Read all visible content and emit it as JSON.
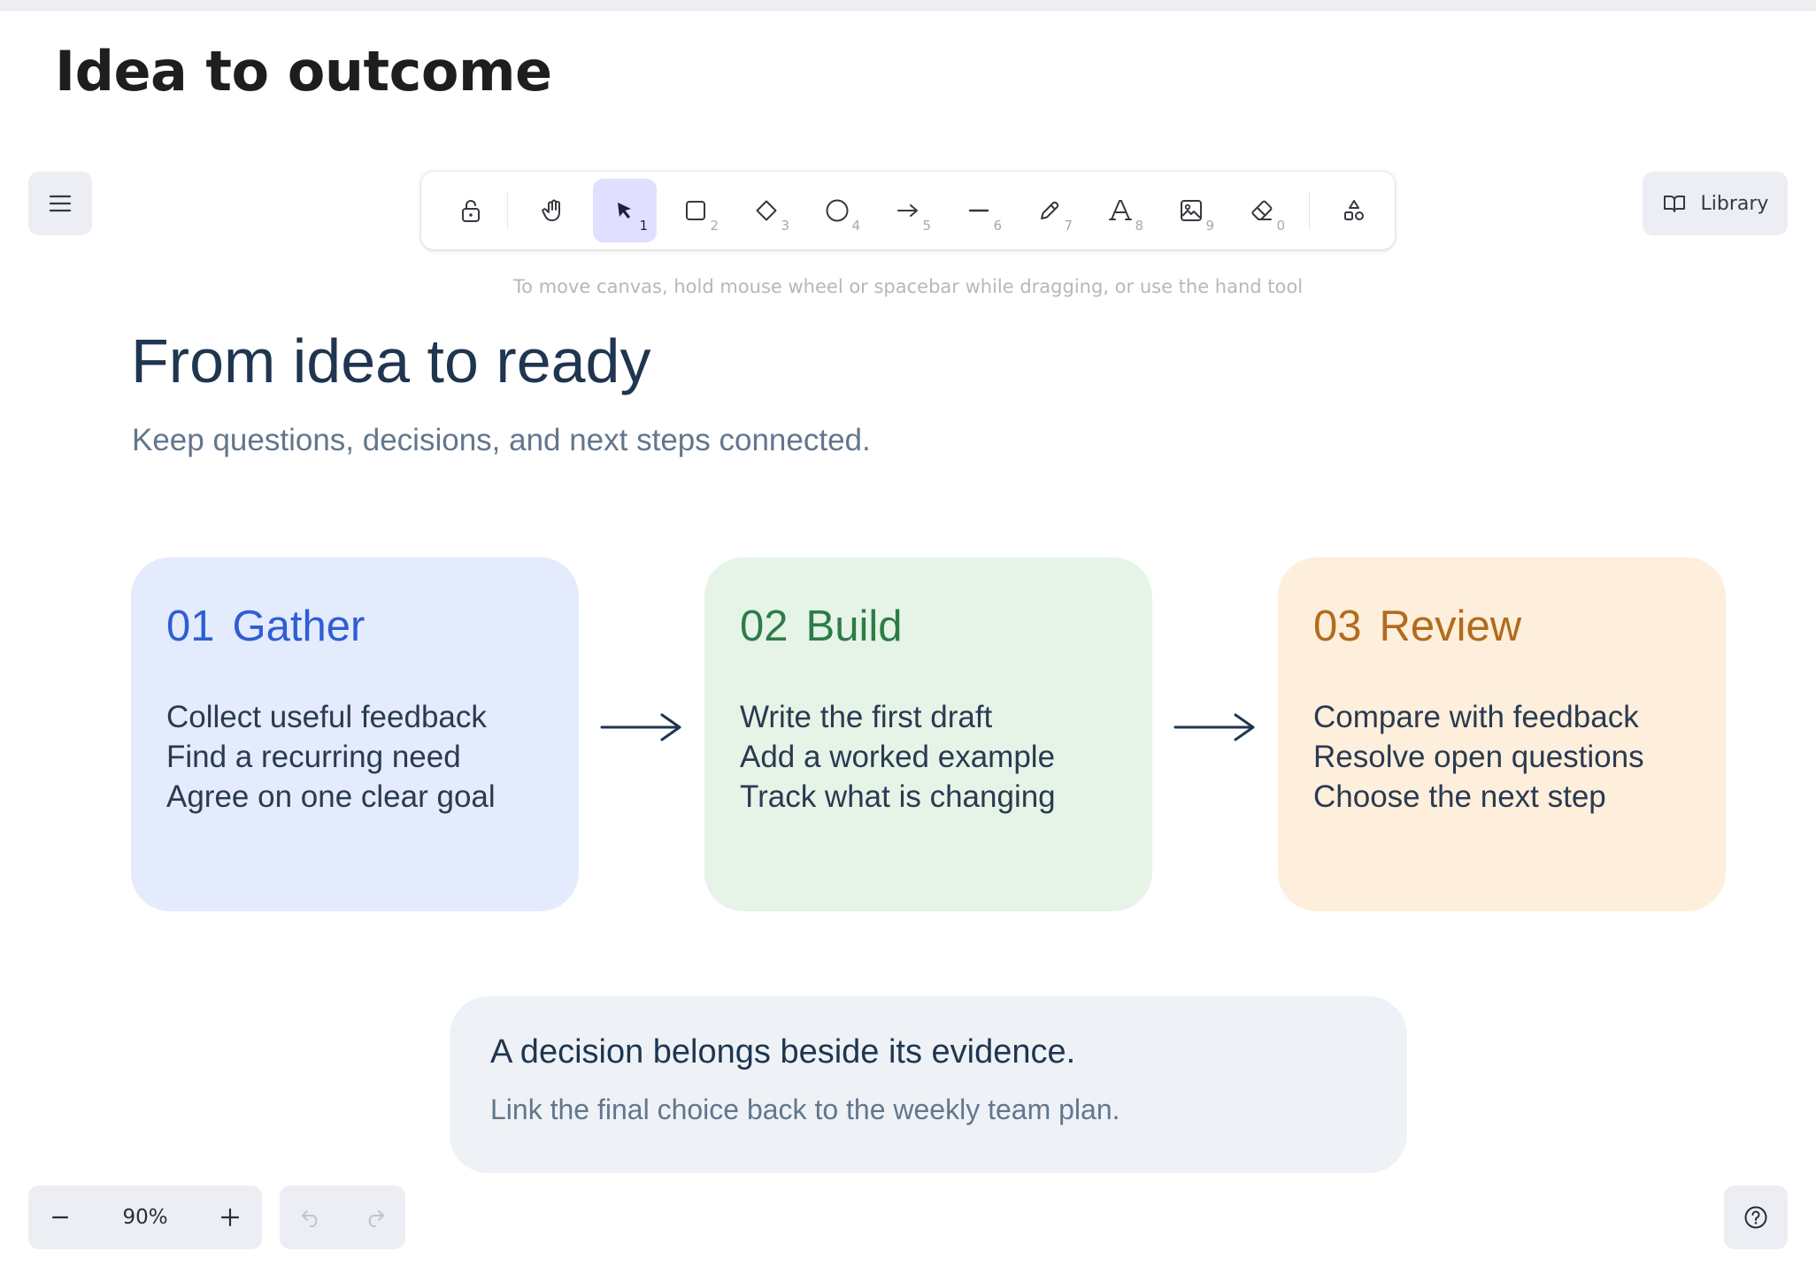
{
  "document": {
    "title": "Idea to outcome"
  },
  "toolbar": {
    "tools": [
      {
        "name": "hand",
        "shortcut": ""
      },
      {
        "name": "selection",
        "shortcut": "1",
        "active": true
      },
      {
        "name": "rectangle",
        "shortcut": "2"
      },
      {
        "name": "diamond",
        "shortcut": "3"
      },
      {
        "name": "ellipse",
        "shortcut": "4"
      },
      {
        "name": "arrow",
        "shortcut": "5"
      },
      {
        "name": "line",
        "shortcut": "6"
      },
      {
        "name": "draw",
        "shortcut": "7"
      },
      {
        "name": "text",
        "shortcut": "8"
      },
      {
        "name": "image",
        "shortcut": "9"
      },
      {
        "name": "eraser",
        "shortcut": "0"
      }
    ],
    "hint": "To move canvas, hold mouse wheel or spacebar while dragging, or use the hand tool"
  },
  "library": {
    "label": "Library"
  },
  "canvas": {
    "heading": "From idea to ready",
    "subheading": "Keep questions, decisions, and next steps connected.",
    "cards": [
      {
        "number": "01",
        "title": "Gather",
        "color": "#2f5ed3",
        "background": "#e3ebfd",
        "items": [
          "Collect useful feedback",
          "Find a recurring need",
          "Agree on one clear goal"
        ]
      },
      {
        "number": "02",
        "title": "Build",
        "color": "#2c7d47",
        "background": "#e6f4e8",
        "items": [
          "Write the first draft",
          "Add a worked example",
          "Track what is changing"
        ]
      },
      {
        "number": "03",
        "title": "Review",
        "color": "#b26b1d",
        "background": "#fdefdc",
        "items": [
          "Compare with feedback",
          "Resolve open questions",
          "Choose the next step"
        ]
      }
    ],
    "note": {
      "title": "A decision belongs beside its evidence.",
      "subtitle": "Link the final choice back to the weekly team plan."
    }
  },
  "footer": {
    "zoom": "90%",
    "icons": [
      "zoom-out-icon",
      "zoom-in-icon",
      "undo-icon",
      "redo-icon",
      "help-icon"
    ]
  },
  "colors": {
    "accent": "#e0dfff",
    "text": "#1f3550",
    "muted": "#62768c"
  }
}
